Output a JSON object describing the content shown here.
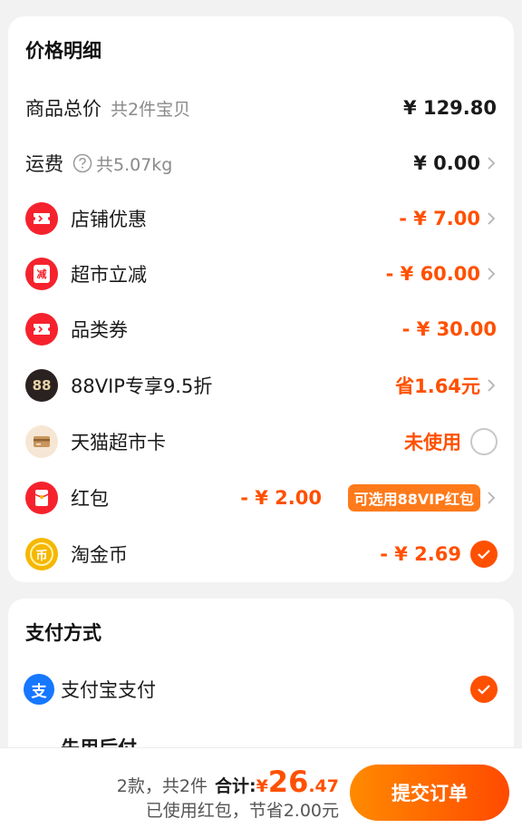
{
  "price_detail": {
    "title": "价格明细",
    "rows": [
      {
        "label": "商品总价",
        "sub": "共2件宝贝",
        "value": "¥ 129.80"
      },
      {
        "label": "运费",
        "sub": "共5.07kg",
        "value": "¥ 0.00"
      },
      {
        "label": "店铺优惠",
        "value": "- ¥ 7.00",
        "icon": "ticket-icon"
      },
      {
        "label": "超市立减",
        "value": "- ¥ 60.00",
        "icon": "discount-icon",
        "icon_text": "减"
      },
      {
        "label": "品类券",
        "value": "- ¥ 30.00",
        "icon": "ticket-icon"
      },
      {
        "label": "88VIP专享9.5折",
        "value": "省1.64元",
        "icon": "vip-88-icon",
        "icon_text": "88"
      },
      {
        "label": "天猫超市卡",
        "value": "未使用",
        "icon": "card-icon"
      },
      {
        "label": "红包",
        "value": "- ¥ 2.00",
        "badge": "可选用88VIP红包",
        "icon": "red-envelope-icon"
      },
      {
        "label": "淘金币",
        "value": "- ¥ 2.69",
        "icon": "coin-icon",
        "icon_text": "币"
      }
    ]
  },
  "payment": {
    "title": "支付方式",
    "options": [
      {
        "label": "支付宝支付",
        "icon": "alipay-icon",
        "icon_text": "支",
        "selected": true
      },
      {
        "label": "先用后付"
      }
    ]
  },
  "bottom": {
    "count_text": "2款，共2件",
    "total_label": "合计:",
    "currency": "¥",
    "total_int": "26",
    "total_dec": ".47",
    "saved_text": "已使用红包，节省2.00元",
    "submit_label": "提交订单"
  },
  "colors": {
    "accent": "#ff5000",
    "badge": "#ff7a1a",
    "ticket_red": "#f5222d",
    "gold": "#f5b700",
    "vip_dark": "#2a2220",
    "alipay_blue": "#1677ff"
  }
}
